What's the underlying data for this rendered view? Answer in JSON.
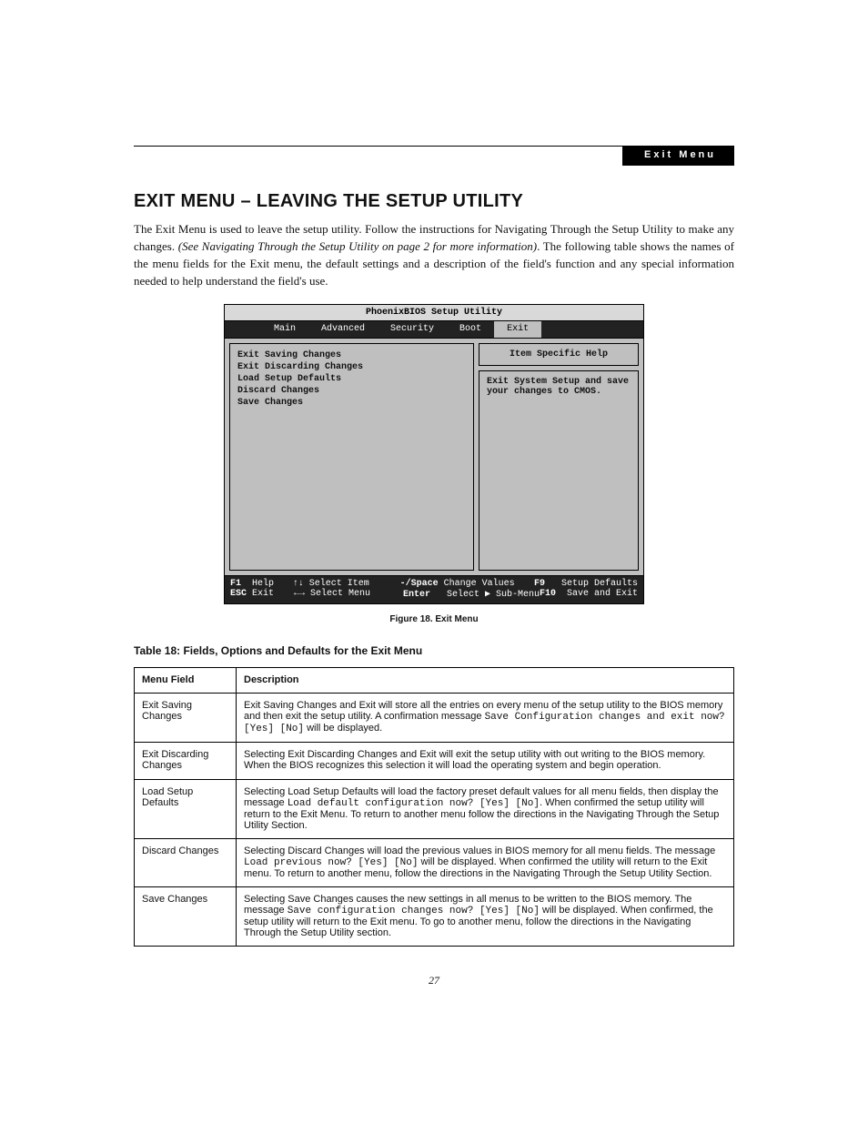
{
  "header": {
    "label": "Exit Menu"
  },
  "title": "EXIT MENU – LEAVING THE SETUP UTILITY",
  "intro": {
    "part1": "The Exit Menu is used to leave the setup utility. Follow the instructions for Navigating Through the Setup Utility to make any changes. ",
    "ital": "(See Navigating Through the Setup Utility on page 2 for more information)",
    "part2": ". The following table shows the names of the menu fields for the Exit menu, the default settings and a description of the field's function and any special information needed to help understand the field's use."
  },
  "bios": {
    "title": "PhoenixBIOS Setup Utility",
    "tabs": [
      "Main",
      "Advanced",
      "Security",
      "Boot",
      "Exit"
    ],
    "active_tab": "Exit",
    "menu_items": [
      "Exit Saving Changes",
      "Exit Discarding Changes",
      "Load Setup Defaults",
      "Discard Changes",
      "Save Changes"
    ],
    "help_title": "Item Specific Help",
    "help_body": "Exit System Setup and save your changes to CMOS.",
    "footer": {
      "r1": {
        "a_key": "F1",
        "a_lbl": "Help",
        "b_arrow": "↑↓",
        "b_lbl": "Select Item",
        "c_key": "-/Space",
        "c_lbl": "Change Values",
        "d_key": "F9",
        "d_lbl": "Setup Defaults"
      },
      "r2": {
        "a_key": "ESC",
        "a_lbl": "Exit",
        "b_arrow": "←→",
        "b_lbl": "Select Menu",
        "c_key": "Enter",
        "c_lbl": "Select ▶ Sub-Menu",
        "d_key": "F10",
        "d_lbl": "Save and Exit"
      }
    }
  },
  "figure_caption": "Figure 18.   Exit Menu",
  "table_title": "Table 18: Fields, Options and Defaults for the Exit Menu",
  "table": {
    "head": {
      "c1": "Menu Field",
      "c2": "Description"
    },
    "rows": [
      {
        "field": "Exit Saving Changes",
        "desc_a": "Exit Saving Changes and Exit will store all the entries on every menu of the setup utility to the BIOS memory and then exit the setup utility. A confirmation message ",
        "mono_a": "Save Configuration changes and exit now? [Yes] [No]",
        "desc_b": " will be displayed."
      },
      {
        "field": "Exit Discarding Changes",
        "desc_a": "Selecting Exit Discarding Changes and Exit will exit the setup utility with out writing to the BIOS memory. When the BIOS recognizes this selection it will load the operating system and begin operation.",
        "mono_a": "",
        "desc_b": ""
      },
      {
        "field": "Load Setup Defaults",
        "desc_a": "Selecting Load Setup Defaults will load the factory preset default values for all menu fields, then display the message ",
        "mono_a": "Load default configuration now? [Yes] [No]",
        "desc_b": ". When confirmed the setup utility will return to the Exit Menu. To return to another menu follow the directions in the Navigating Through the Setup Utility Section."
      },
      {
        "field": "Discard Changes",
        "desc_a": "Selecting Discard Changes will load the previous values in BIOS memory for all menu fields. The message ",
        "mono_a": "Load previous now? [Yes] [No]",
        "desc_b": " will be displayed. When confirmed the utility will return to the Exit menu. To return to another menu, follow the directions in the Navigating Through the Setup Utility Section."
      },
      {
        "field": "Save Changes",
        "desc_a": "Selecting Save Changes causes the new settings in all menus to be written to the BIOS memory. The message ",
        "mono_a": "Save configuration changes now? [Yes] [No]",
        "desc_b": " will be displayed. When confirmed, the setup utility will return to the Exit menu. To go to another menu, follow the directions in the Navigating Through the Setup Utility section."
      }
    ]
  },
  "page_number": "27"
}
